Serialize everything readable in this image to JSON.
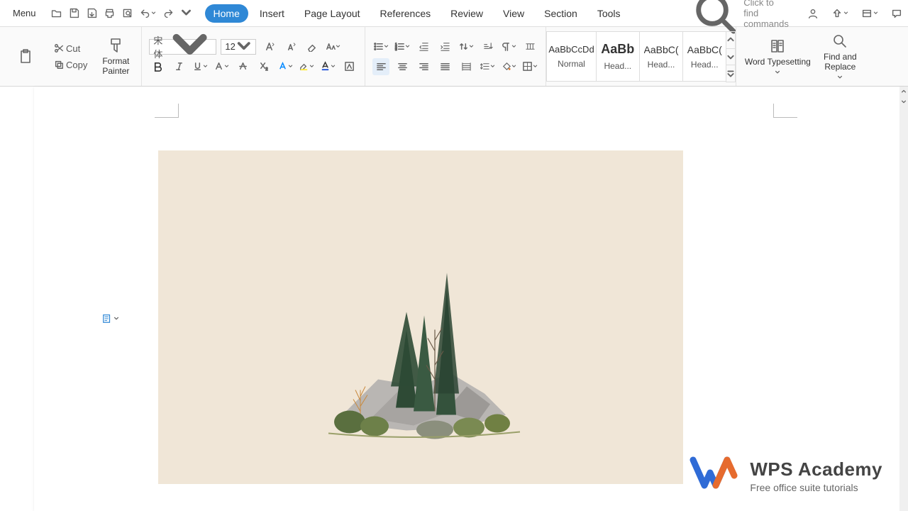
{
  "menu": {
    "label": "Menu"
  },
  "search_hint": "Click to find commands",
  "tabs": {
    "home": "Home",
    "insert": "Insert",
    "page_layout": "Page Layout",
    "references": "References",
    "review": "Review",
    "view": "View",
    "section": "Section",
    "tools": "Tools"
  },
  "clipboard": {
    "cut": "Cut",
    "copy": "Copy",
    "format_painter": "Format\nPainter"
  },
  "font": {
    "name": "宋体",
    "size": "12"
  },
  "styles": [
    {
      "preview": "AaBbCcDd",
      "label": "Normal"
    },
    {
      "preview": "AaBb",
      "label": "Head..."
    },
    {
      "preview": "AaBbC(",
      "label": "Head..."
    },
    {
      "preview": "AaBbC(",
      "label": "Head..."
    }
  ],
  "bigbtns": {
    "word_typesetting": "Word Typesetting",
    "find_replace": "Find and\nReplace"
  },
  "brand": {
    "title": "WPS Academy",
    "subtitle": "Free office suite tutorials"
  }
}
